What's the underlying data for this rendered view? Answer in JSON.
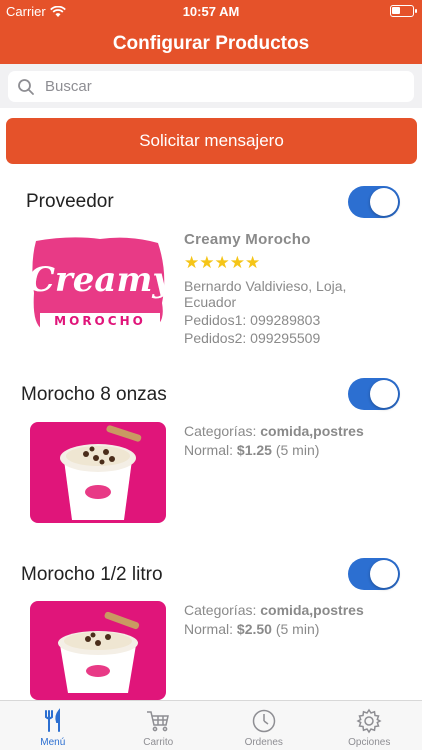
{
  "status_bar": {
    "carrier": "Carrier",
    "time": "10:57 AM"
  },
  "header": {
    "title": "Configurar Productos"
  },
  "search": {
    "placeholder": "Buscar"
  },
  "request_button": {
    "label": "Solicitar mensajero"
  },
  "provider": {
    "section_label": "Proveedor",
    "toggle_on": true,
    "logo_text_top": "Creamy",
    "logo_text_bottom": "MOROCHO",
    "name": "Creamy Morocho",
    "rating_stars": "★★★★★",
    "address": "Bernardo Valdivieso, Loja,",
    "address_line2": "Ecuador",
    "phone1": "Pedidos1: 099289803",
    "phone2": "Pedidos2: 099295509"
  },
  "products": [
    {
      "name": "Morocho 8 onzas",
      "toggle_on": true,
      "categories_label": "Categorías:",
      "categories": "comida,postres",
      "price_label": "Normal:",
      "price": "$1.25",
      "time": "(5 min)"
    },
    {
      "name": "Morocho 1/2 litro",
      "toggle_on": true,
      "categories_label": "Categorías:",
      "categories": "comida,postres",
      "price_label": "Normal:",
      "price": "$2.50",
      "time": "(5 min)"
    }
  ],
  "tabs": [
    {
      "label": "Menú",
      "icon": "fork-knife-icon",
      "active": true
    },
    {
      "label": "Carrito",
      "icon": "cart-icon",
      "active": false
    },
    {
      "label": "Ordenes",
      "icon": "clock-icon",
      "active": false
    },
    {
      "label": "Opciones",
      "icon": "gear-icon",
      "active": false
    }
  ],
  "colors": {
    "accent": "#e5522a",
    "toggle": "#2c6fd1",
    "brand_pink": "#e0157a"
  }
}
